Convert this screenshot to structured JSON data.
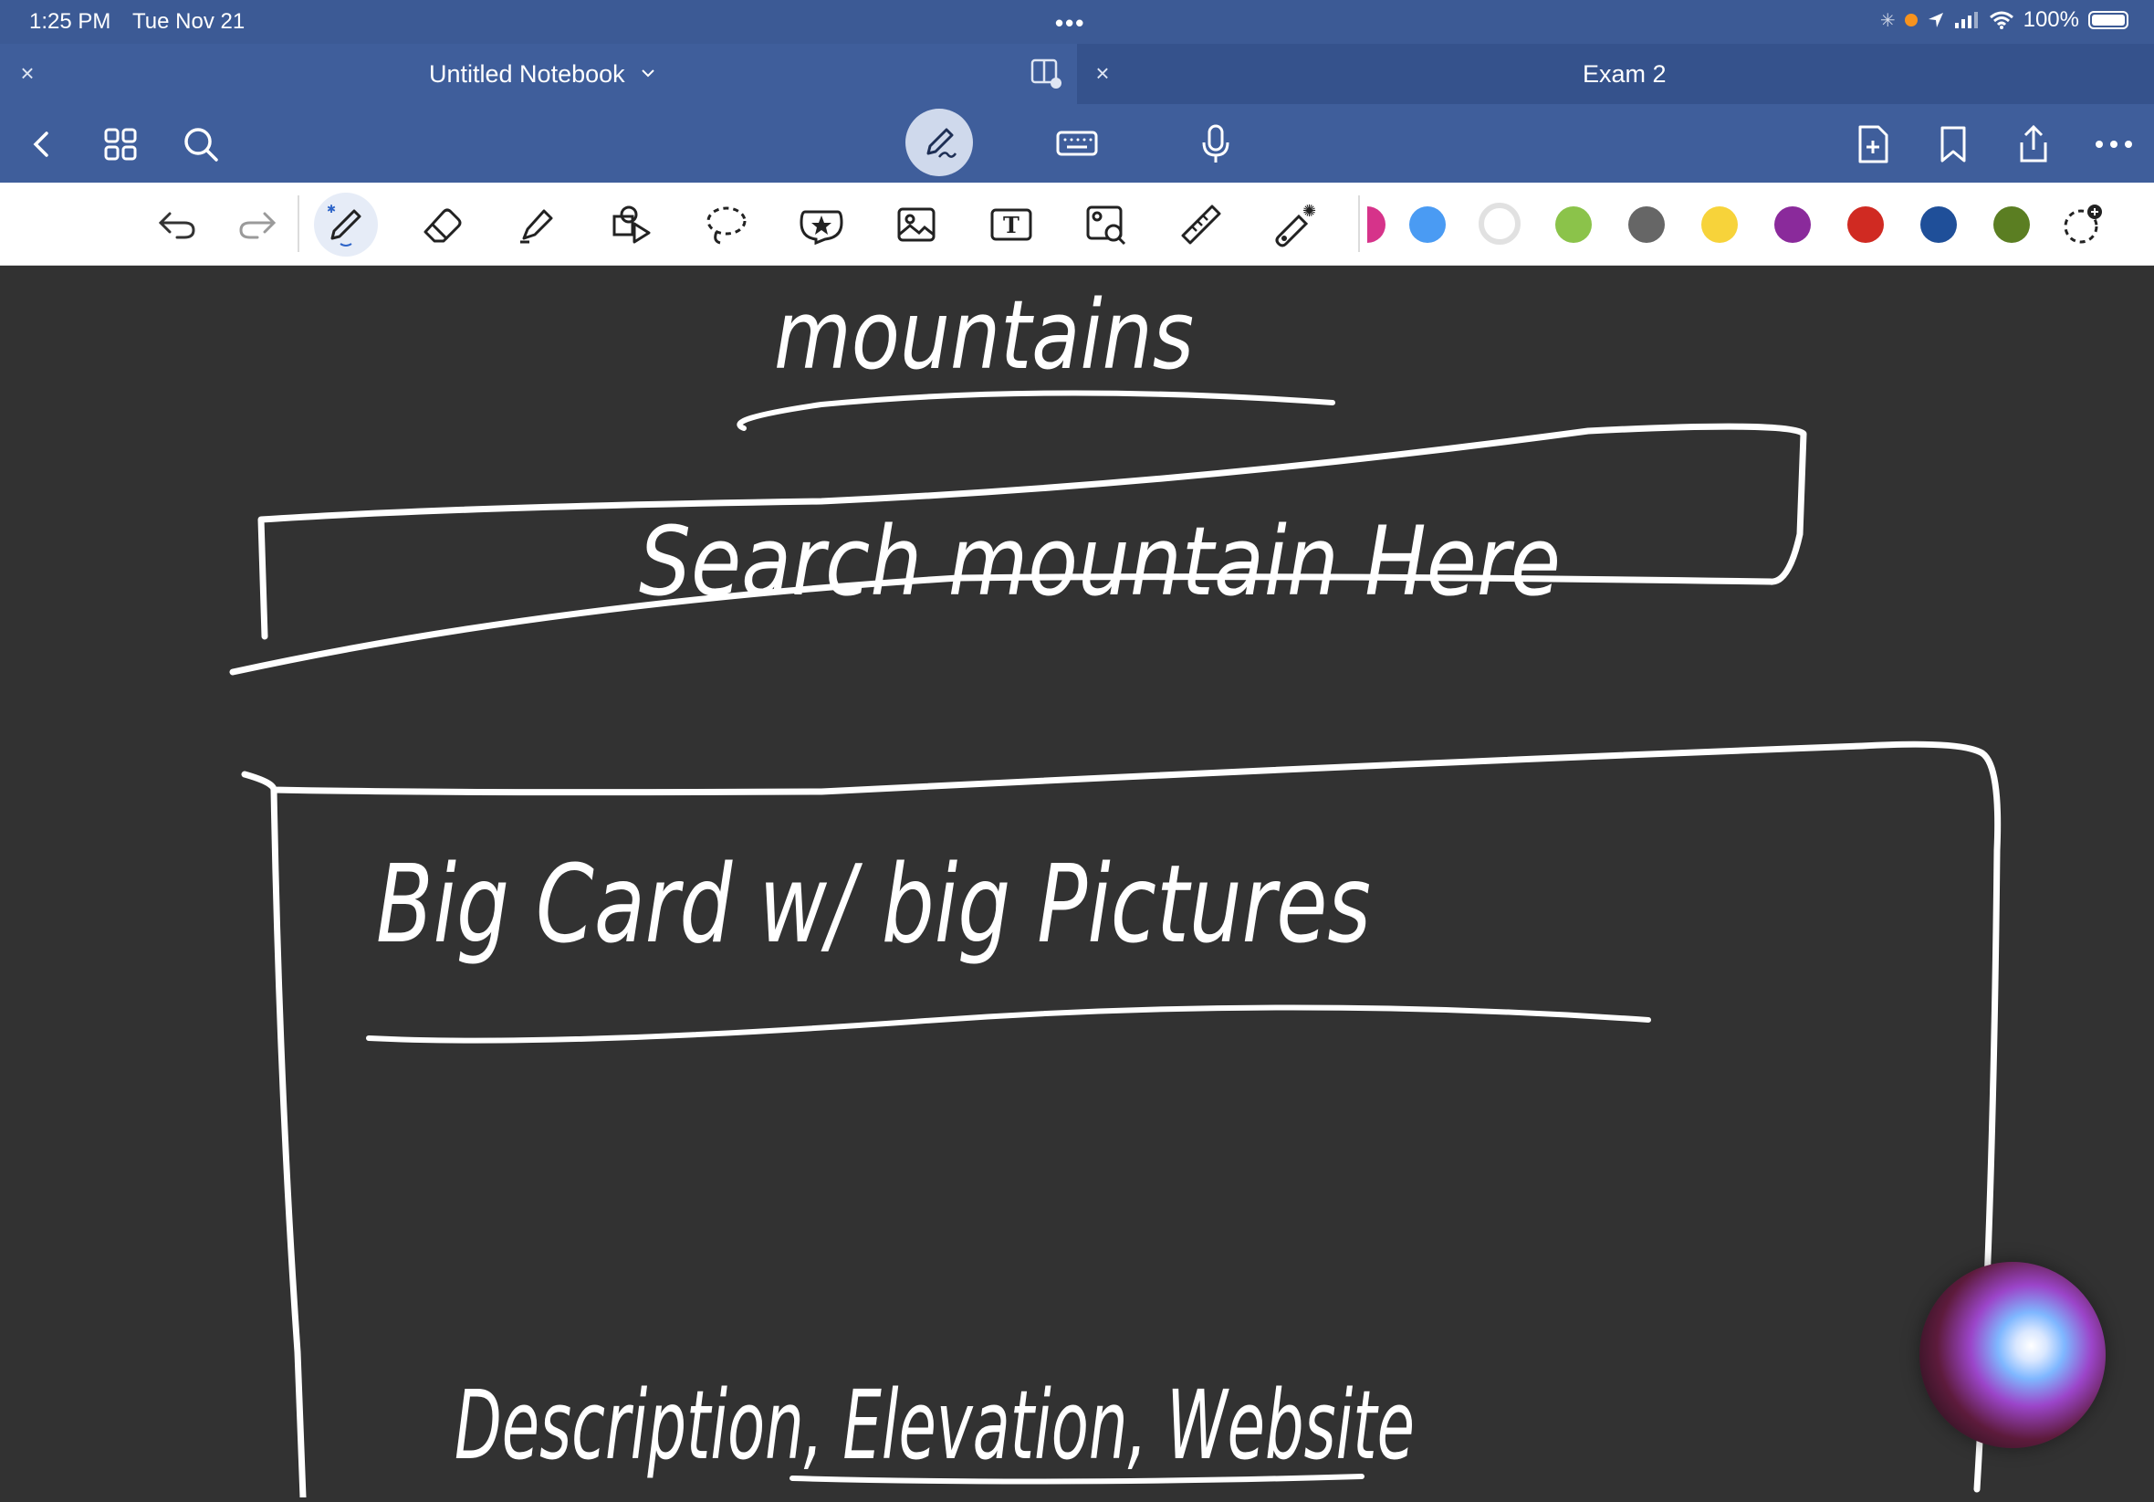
{
  "status": {
    "time": "1:25 PM",
    "date": "Tue Nov 21",
    "battery": "100%"
  },
  "tabs": [
    {
      "title": "Untitled Notebook",
      "active": true
    },
    {
      "title": "Exam 2",
      "active": false
    }
  ],
  "nav": {
    "left": [
      "back-icon",
      "grid-icon",
      "search-icon"
    ],
    "center": [
      "pen-mode-icon",
      "keyboard-icon",
      "microphone-icon"
    ],
    "right": [
      "add-page-icon",
      "bookmark-icon",
      "share-icon",
      "more-icon"
    ]
  },
  "toolbar": {
    "tools": [
      "undo-icon",
      "redo-icon",
      "pen-icon",
      "eraser-icon",
      "highlighter-icon",
      "shapes-icon",
      "lasso-icon",
      "sticker-icon",
      "image-icon",
      "text-icon",
      "image-search-icon",
      "ruler-icon",
      "laser-pointer-icon"
    ],
    "selected_tool": "pen-icon",
    "colors": [
      "#d6338a",
      "#4a9bf3",
      "#ffffff",
      "#8bc34a",
      "#666666",
      "#f7d33a",
      "#8a2a9b",
      "#d02a22",
      "#1f4f99",
      "#5b7e22"
    ],
    "selected_color": "#ffffff"
  },
  "handwriting": {
    "title": "mountains",
    "search_box": "Search mountain Here",
    "card_heading": "Big Card w/ big Pictures",
    "card_footer": "Description, Elevation, Website"
  }
}
